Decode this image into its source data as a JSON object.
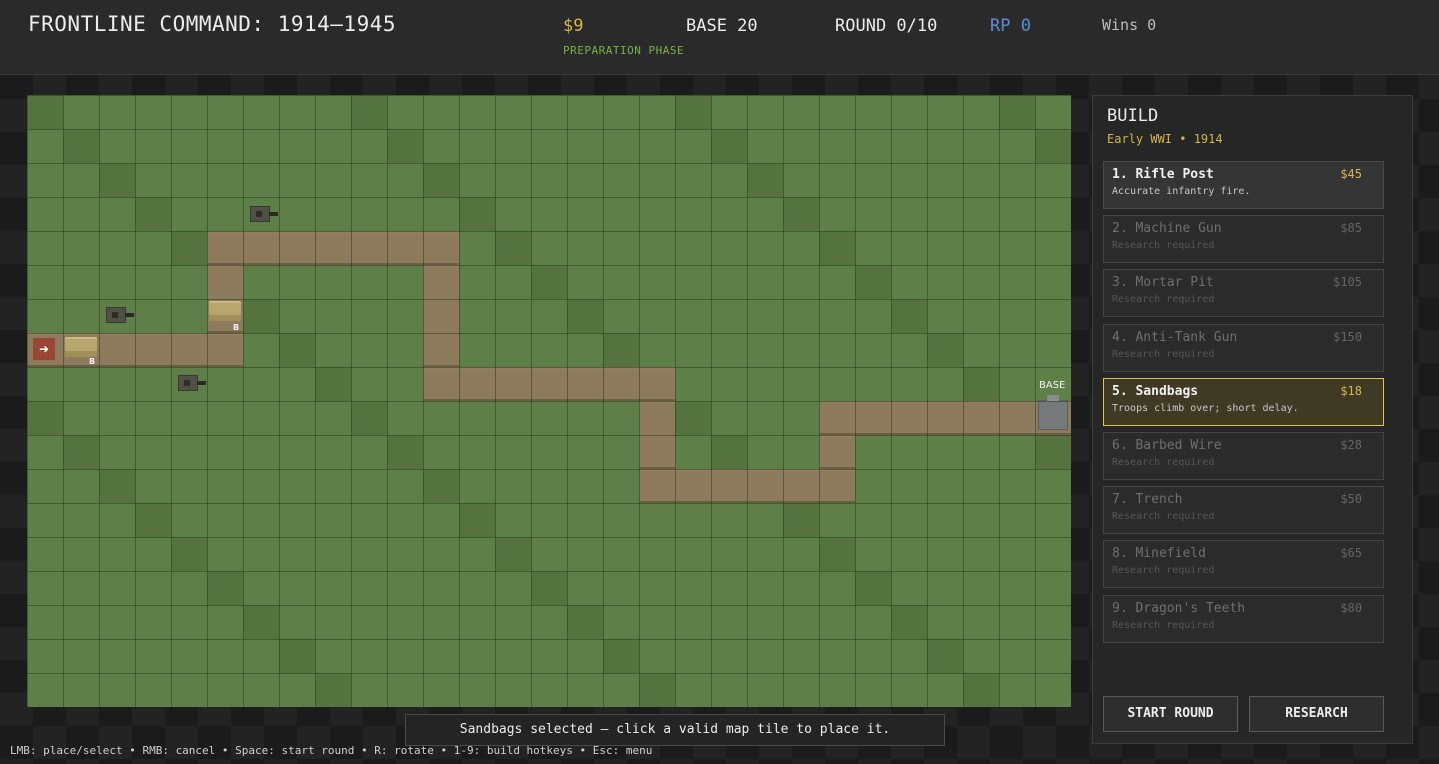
{
  "hud": {
    "title": "FRONTLINE COMMAND: 1914–1945",
    "money": "$9",
    "base_hp": "BASE 20",
    "round": "ROUND 0/10",
    "rp": "RP 0",
    "wins": "Wins 0",
    "phase": "PREPARATION PHASE"
  },
  "map": {
    "base_label": "BASE",
    "spawn_icon": "arrow-right-icon",
    "sandbag_marker": "B"
  },
  "build": {
    "title": "BUILD",
    "era": "Early WWI • 1914",
    "items": [
      {
        "name": "1. Rifle Post",
        "cost": "$45",
        "desc": "Accurate infantry fire.",
        "state": "available"
      },
      {
        "name": "2. Machine Gun",
        "cost": "$85",
        "desc": "Research required",
        "state": "locked"
      },
      {
        "name": "3. Mortar Pit",
        "cost": "$105",
        "desc": "Research required",
        "state": "locked"
      },
      {
        "name": "4. Anti-Tank Gun",
        "cost": "$150",
        "desc": "Research required",
        "state": "locked"
      },
      {
        "name": "5. Sandbags",
        "cost": "$18",
        "desc": "Troops climb over; short delay.",
        "state": "selected"
      },
      {
        "name": "6. Barbed Wire",
        "cost": "$28",
        "desc": "Research required",
        "state": "locked"
      },
      {
        "name": "7. Trench",
        "cost": "$50",
        "desc": "Research required",
        "state": "locked"
      },
      {
        "name": "8. Minefield",
        "cost": "$65",
        "desc": "Research required",
        "state": "locked"
      },
      {
        "name": "9. Dragon's Teeth",
        "cost": "$80",
        "desc": "Research required",
        "state": "locked"
      }
    ],
    "start_label": "START ROUND",
    "research_label": "RESEARCH"
  },
  "toast": "Sandbags selected — click a valid map tile to place it.",
  "help": "LMB: place/select • RMB: cancel • Space: start round • R: rotate • 1-9: build hotkeys • Esc: menu",
  "colors": {
    "grass": "#5f7f48",
    "path": "#8e7b5d",
    "gold": "#d9b64a",
    "rp_blue": "#5a8ed6",
    "phase_green": "#77b04b",
    "selected_border": "#e0c34f"
  }
}
